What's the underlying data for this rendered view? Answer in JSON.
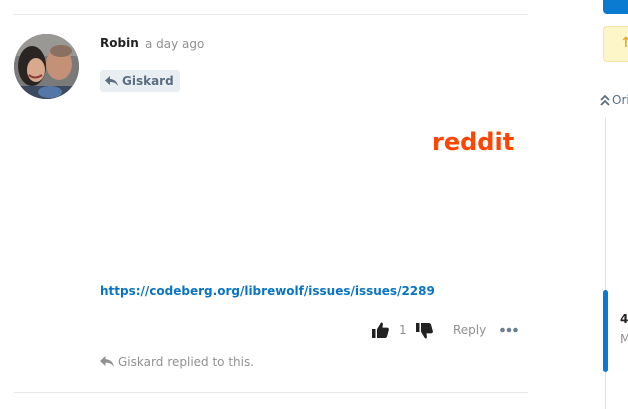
{
  "post": {
    "author": "Robin",
    "timestamp": "a day ago",
    "reply_to": "Giskard",
    "embed_text": "reddit",
    "link_text": "https://codeberg.org/librewolf/issues/issues/2289",
    "vote_count": "1",
    "reply_label": "Reply",
    "replied_by": "Giskard",
    "replied_suffix": "replied to this."
  },
  "sidebar": {
    "original_label": "Ori",
    "notice_glyph": "↑",
    "index_number": "4",
    "index_date": "M"
  },
  "icons": {
    "reply_chip": "reply-icon",
    "vote_up": "thumbs-up-icon",
    "vote_down": "thumbs-down-icon",
    "more": "more-options-icon",
    "replied": "reply-icon",
    "original": "double-chevron-up-icon"
  },
  "colors": {
    "link": "#0a74c4",
    "reddit": "#ff4500",
    "muted": "#919191",
    "accent": "#0a7bd0"
  }
}
